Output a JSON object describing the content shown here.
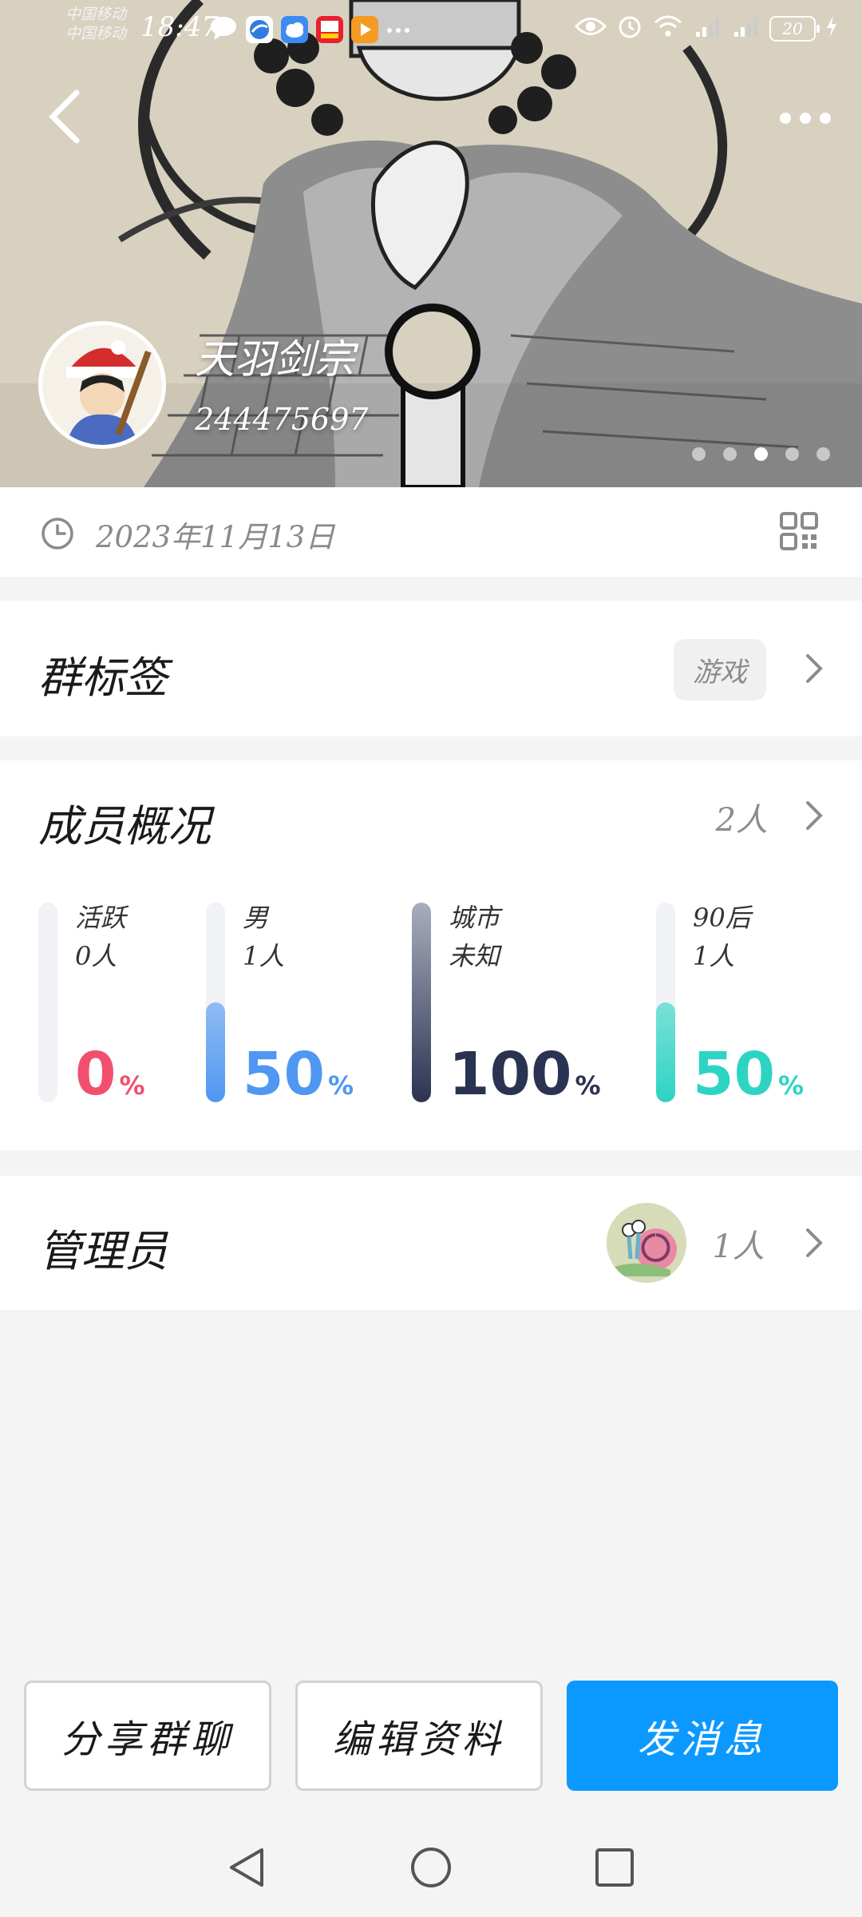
{
  "status_bar": {
    "carrier_1": "中国移动",
    "carrier_2": "中国移动",
    "time": "18:47",
    "battery": "20",
    "notification_icons": [
      "message-bubble-icon",
      "browser-icon",
      "cloud-icon",
      "shopping-1111-icon",
      "video-play-icon",
      "more-dots-icon"
    ],
    "system_icons": [
      "eye-icon",
      "alarm-icon",
      "wifi-icon",
      "signal-4g-icon",
      "signal-4g-icon",
      "battery-icon",
      "charging-icon"
    ]
  },
  "header": {
    "group_name": "天羽剑宗",
    "group_id": "244475697",
    "carousel_pages": 5,
    "carousel_active_index": 2
  },
  "info": {
    "created_date": "2023年11月13日"
  },
  "tags": {
    "title": "群标签",
    "tag": "游戏"
  },
  "members": {
    "title": "成员概况",
    "count": "2人",
    "stats": [
      {
        "label": "活跃",
        "value": "0人",
        "percent": "0",
        "percent_unit": "%",
        "fill": 0.0,
        "color": "#f0506e"
      },
      {
        "label": "男",
        "value": "1人",
        "percent": "50",
        "percent_unit": "%",
        "fill": 0.5,
        "color": "#4f97f2"
      },
      {
        "label": "城市",
        "value": "未知",
        "percent": "100",
        "percent_unit": "%",
        "fill": 1.0,
        "color": "#2b3352"
      },
      {
        "label": "90后",
        "value": "1人",
        "percent": "50",
        "percent_unit": "%",
        "fill": 0.5,
        "color": "#2dd4c4"
      }
    ]
  },
  "admins": {
    "title": "管理员",
    "count": "1人"
  },
  "actions": {
    "share": "分享群聊",
    "edit": "编辑资料",
    "send": "发消息"
  },
  "colors": {
    "primary": "#0b99ff",
    "background": "#f4f4f4",
    "muted_text": "#8c8c8c"
  }
}
